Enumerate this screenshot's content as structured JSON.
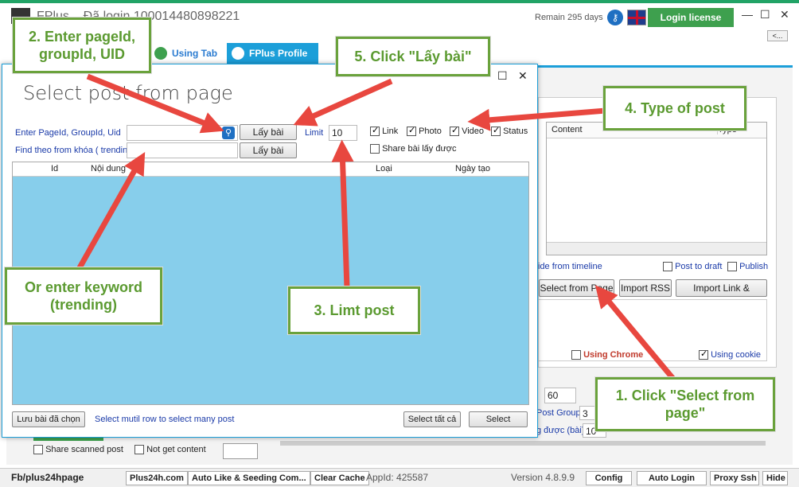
{
  "app": {
    "title": "FPlus  ...Đã login  100014480898221",
    "remain": "Remain 295 days",
    "login_label": "Login license",
    "back_label": "<...",
    "tabs": [
      {
        "label": "Using Tab"
      },
      {
        "label": "FPlus Profile"
      }
    ]
  },
  "dialog": {
    "title": "Select post from page",
    "enter_label": "Enter PageId, GroupId, Uid",
    "find_label": "Find theo from khóa ( trending",
    "laybai": "Lấy bài",
    "limit_label": "Limit",
    "limit_value": "10",
    "types": [
      {
        "label": "Link",
        "checked": true
      },
      {
        "label": "Photo",
        "checked": true
      },
      {
        "label": "Video",
        "checked": true
      },
      {
        "label": "Status",
        "checked": true
      }
    ],
    "share_label": "Share bài lấy được",
    "columns": [
      "Id",
      "Nội dung",
      "Loại",
      "Ngày tạo"
    ],
    "save_selected": "Lưu bài đã chọn",
    "hint": "Select mutil row to select many post",
    "select_all": "Select tất cả",
    "select": "Select"
  },
  "right": {
    "col_content": "Content",
    "col_type": "Type",
    "hide_timeline": "ide from timeline",
    "post_draft": "Post to draft",
    "publish": "Publish",
    "select_from_page": "Select from Page",
    "import_rss": "Import RSS",
    "import_link": "Import Link & Sitemap",
    "using_chrome": "Using Chrome",
    "using_cookie": "Using cookie",
    "num60": "60",
    "post_group": "Post Group",
    "post_group_value": "3",
    "lay_duoc": "g được (bài)",
    "lay_duoc_value": "10"
  },
  "bottom": {
    "share_scanned": "Share scanned post",
    "not_get_content": "Not get content"
  },
  "status": {
    "fb": "Fb/plus24hpage",
    "plus24h": "Plus24h.com",
    "auto_like": "Auto Like & Seeding Com...",
    "clear_cache": "Clear Cache",
    "appid": "AppId: 425587",
    "version": "Version 4.8.9.9",
    "config": "Config",
    "auto_login": "Auto Login",
    "proxy": "Proxy Ssh",
    "hide": "Hide"
  },
  "notes": {
    "n1": "1. Click \"Select from page\"",
    "n2": "2. Enter pageId, groupId, UID",
    "n3": "3. Limt post",
    "n4": "4. Type of post",
    "n5": "5. Click \"Lấy bài\"",
    "n6": "Or enter keyword (trending)"
  },
  "colors": {
    "accent": "#1c9fd9",
    "note_green": "#6aa23c",
    "arrow": "#e8473f",
    "table_bg": "#87ceeb"
  }
}
